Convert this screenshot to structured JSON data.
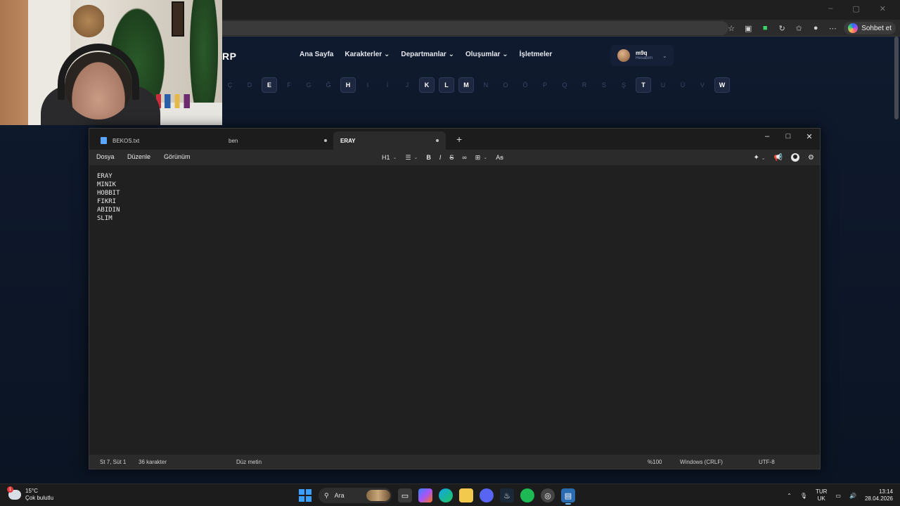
{
  "browser": {
    "copilot_label": "Sohbet et",
    "window_controls": [
      "–",
      "▢",
      "✕"
    ]
  },
  "site": {
    "logo": "RP",
    "nav": [
      "Ana Sayfa",
      "Karakterler",
      "Departmanlar",
      "Oluşumlar",
      "İşletmeler"
    ],
    "account": {
      "name": "m9q",
      "subtitle": "Hesabım"
    },
    "letters": [
      {
        "char": "Ç",
        "active": false
      },
      {
        "char": "D",
        "active": false
      },
      {
        "char": "E",
        "active": true
      },
      {
        "char": "F",
        "active": false
      },
      {
        "char": "G",
        "active": false
      },
      {
        "char": "Ğ",
        "active": false
      },
      {
        "char": "H",
        "active": true
      },
      {
        "char": "I",
        "active": false
      },
      {
        "char": "İ",
        "active": false
      },
      {
        "char": "J",
        "active": false
      },
      {
        "char": "K",
        "active": true
      },
      {
        "char": "L",
        "active": true
      },
      {
        "char": "M",
        "active": true
      },
      {
        "char": "N",
        "active": false
      },
      {
        "char": "O",
        "active": false
      },
      {
        "char": "Ö",
        "active": false
      },
      {
        "char": "P",
        "active": false
      },
      {
        "char": "Q",
        "active": false
      },
      {
        "char": "R",
        "active": false
      },
      {
        "char": "S",
        "active": false
      },
      {
        "char": "Ş",
        "active": false
      },
      {
        "char": "T",
        "active": true
      },
      {
        "char": "U",
        "active": false
      },
      {
        "char": "Ü",
        "active": false
      },
      {
        "char": "V",
        "active": false
      },
      {
        "char": "W",
        "active": true
      }
    ]
  },
  "notepad": {
    "tabs": [
      {
        "label": "BEKOS.txt",
        "active": false,
        "modified": false
      },
      {
        "label": "ben",
        "active": false,
        "modified": true
      },
      {
        "label": "ERAY",
        "active": true,
        "modified": true
      }
    ],
    "new_tab": "+",
    "window_controls": [
      "–",
      "□",
      "✕"
    ],
    "menu": [
      "Dosya",
      "Düzenle",
      "Görünüm"
    ],
    "heading_select": "H1",
    "content_lines": [
      "ERAY",
      "MINIK",
      "HOBBIT",
      "FIKRI",
      "ABIDIN",
      "SLIM"
    ],
    "status": {
      "position": "St 7, Süt 1",
      "chars": "36 karakter",
      "format": "Düz metin",
      "zoom": "%100",
      "line_endings": "Windows (CRLF)",
      "encoding": "UTF-8"
    }
  },
  "taskbar": {
    "weather_temp": "15°C",
    "weather_desc": "Çok bulutlu",
    "weather_badge": "1",
    "search_label": "Ara",
    "lang_top": "TUR",
    "lang_bottom": "UK",
    "time": "13:14",
    "date": "28.04.2026"
  },
  "colors": {
    "accent": "#3aa0ff",
    "notepad_bg": "#202020",
    "site_bg": "#0f1a2e"
  }
}
